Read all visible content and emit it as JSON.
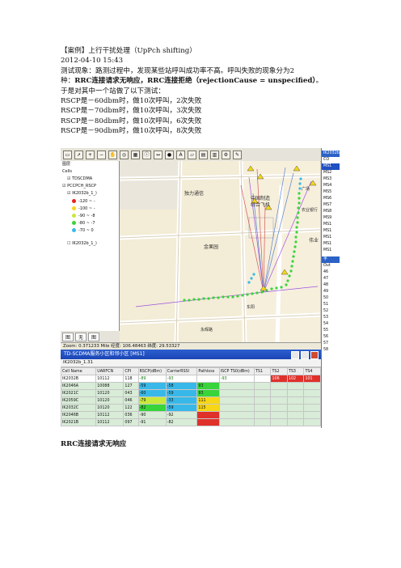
{
  "article": {
    "title": "【案例】上行干扰处理（UpPch shifting）",
    "date": "2012-04-10 15:43",
    "para1_line1": "测试现象：路测过程中，发现某些站呼叫成功率不高。呼叫失败的现象分为2",
    "para1_line2_a": "种：",
    "para1_line2_b": "RRC连接请求无响应，RRC连接拒绝（rejectionCause = unspecified）",
    "para1_line2_c": "。",
    "para1_line3": "于是对其中一个站做了以下测试：",
    "tests": [
      "RSCP是－60dbm时，做10次呼叫，2次失败",
      "RSCP是－70dbm时，做10次呼叫，3次失败",
      "RSCP是－80dbm时，做10次呼叫，6次失败",
      "RSCP是－90dbm时，做10次呼叫，8次失败"
    ],
    "caption": "RRC连接请求无响应"
  },
  "screenshot": {
    "tree": {
      "header": "图层",
      "cells": "Cells",
      "tdscdma": "TDSCDMA",
      "pccpch": "PCCPCH_RSCP",
      "file": "IK2032b_1_)",
      "file2": "IK2032b_1_)"
    },
    "legend": [
      {
        "label": "-120 ~ -",
        "color": "#e8231b"
      },
      {
        "label": "-100 ~ -",
        "color": "#f7d715"
      },
      {
        "label": "-90 ~ -8",
        "color": "#c8e83a"
      },
      {
        "label": "-80 ~ -7",
        "color": "#38d43a"
      },
      {
        "label": "-70 ~ 0",
        "color": "#38b8e8"
      }
    ],
    "left_tabs": [
      "图",
      "无",
      "图"
    ],
    "map_labels": {
      "duli": "独力通信",
      "zhongguo": "中国制造",
      "zonghe": "综合飞机",
      "jinguoyuan": "金果园",
      "nongye": "农业银行",
      "weiye": "伟业",
      "dongyang": "东阳",
      "street": "永辉路",
      "hongfu": "广场"
    },
    "status": "Zoom: 0.371233 Mile  经度: 106.48463  纬度: 29.53327",
    "cell_window_title": "TD-SCDMA服务小区和邻小区 [MS1]",
    "cell_window_sub": "IK2032b_1.31",
    "table": {
      "headers": [
        "Cell Name",
        "UARFCN",
        "CPI",
        "RSCP(dBm)",
        "CarrierRSSI",
        "Pathloss",
        "ISCP TS0(dBm)",
        "TS1",
        "TS2",
        "TS3",
        "TS4"
      ],
      "rows": [
        [
          "IK2032B",
          "10112",
          "118",
          "-89",
          "-93",
          "",
          "-93",
          "",
          "106",
          "102",
          "101"
        ],
        [
          "IK2046A",
          "10088",
          "127",
          "-59",
          "-58",
          "93",
          "",
          "",
          "",
          "",
          ""
        ],
        [
          "IK2021C",
          "10120",
          "043",
          "-60",
          "-59",
          "93",
          "",
          "",
          "",
          "",
          ""
        ],
        [
          "IK2059C",
          "10120",
          "046",
          "-79",
          "-33",
          "111",
          "",
          "",
          "",
          "",
          ""
        ],
        [
          "IK2032C",
          "10120",
          "122",
          "-82",
          "-59",
          "115",
          "",
          "",
          "",
          "",
          ""
        ],
        [
          "IK2046B",
          "10112",
          "036",
          "-90",
          "-92",
          "",
          "",
          "",
          "",
          "",
          ""
        ],
        [
          "IK2021B",
          "10112",
          "097",
          "-91",
          "-82",
          "",
          "",
          "",
          "",
          "",
          ""
        ]
      ]
    },
    "right_panel": {
      "header": "IK2032b",
      "items": [
        "CO",
        "MS1",
        "MS2",
        "MS3",
        "MS4",
        "MS5",
        "MS6",
        "MS7",
        "MS8",
        "MS9",
        "MS1",
        "MS1",
        "MS1",
        "MS1",
        "MS1"
      ],
      "header2": "手",
      "sub": "Out",
      "numbers": [
        "46",
        "47",
        "48",
        "49",
        "50",
        "51",
        "52",
        "53",
        "54",
        "55",
        "56",
        "57",
        "58"
      ]
    }
  }
}
